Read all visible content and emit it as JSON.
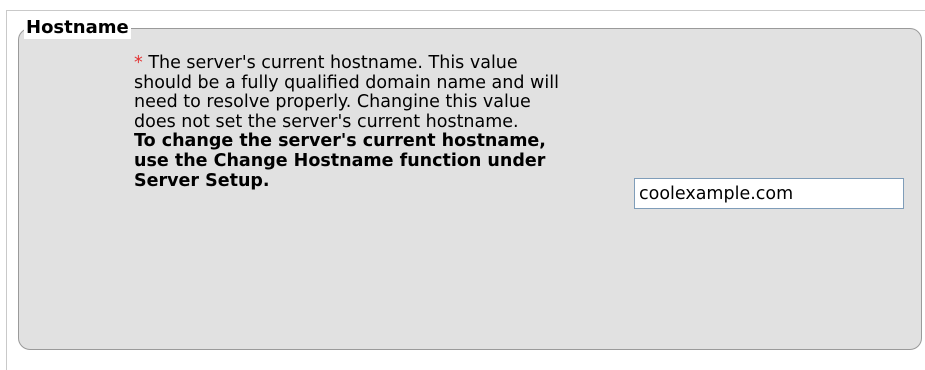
{
  "fieldset": {
    "legend": "Hostname"
  },
  "description": {
    "required_marker": "*",
    "text": " The server's current hostname. This value should be a fully qualified domain name and will need to resolve properly. Changine this value does not set the server's current hostname.",
    "note": "To change the server's current hostname, use the Change Hostname function under Server Setup."
  },
  "hostname_input": {
    "value": "coolexample.com"
  },
  "colors": {
    "fieldset_background": "#e1e1e1",
    "required_marker": "#e23232",
    "border": "#9a9a9a"
  }
}
